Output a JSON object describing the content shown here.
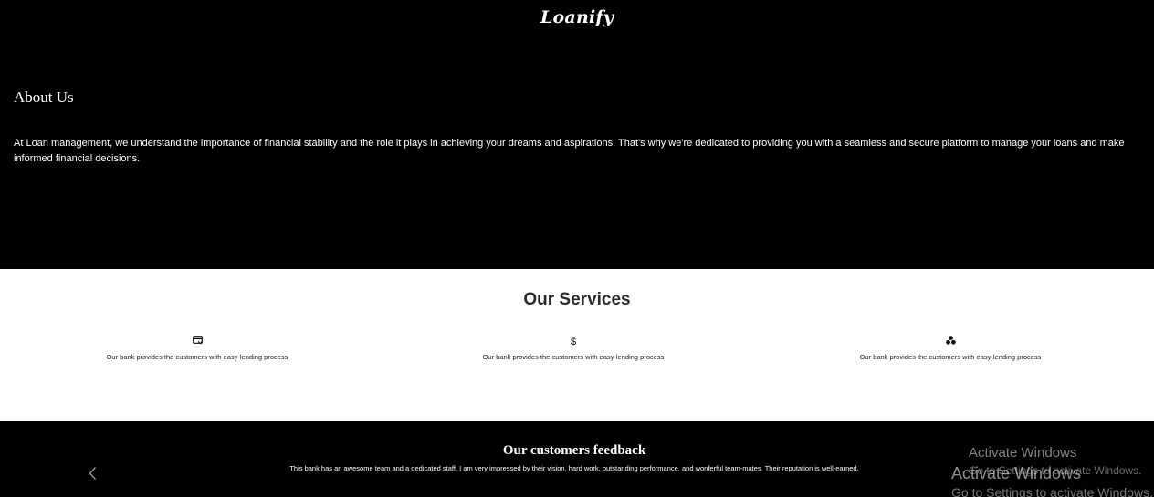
{
  "header": {
    "logo": "Loanify"
  },
  "about": {
    "title": "About Us",
    "text": "At Loan management, we understand the importance of financial stability and the role it plays in achieving your dreams and aspirations. That's why we're dedicated to providing you with a seamless and secure platform to manage your loans and make informed financial decisions."
  },
  "services": {
    "title": "Our Services",
    "items": [
      {
        "icon": "credit-card-icon",
        "text": "Our bank provides the customers with easy-lending process"
      },
      {
        "icon": "dollar-icon",
        "glyph": "$",
        "text": "Our bank provides the customers with easy-lending process"
      },
      {
        "icon": "coins-stack-icon",
        "text": "Our bank provides the customers with easy-lending process"
      }
    ]
  },
  "feedback": {
    "title": "Our customers feedback",
    "quote": "This bank has an awesome team and a dedicated staff. I am very impressed by their vision, hard work, outstanding performance, and wonferful team-mates. Their reputation is well-earned.",
    "prev_icon": "chevron-left-icon"
  },
  "windows_watermark": {
    "title": "Activate Windows",
    "subtitle": "Go to Settings to activate Windows."
  }
}
